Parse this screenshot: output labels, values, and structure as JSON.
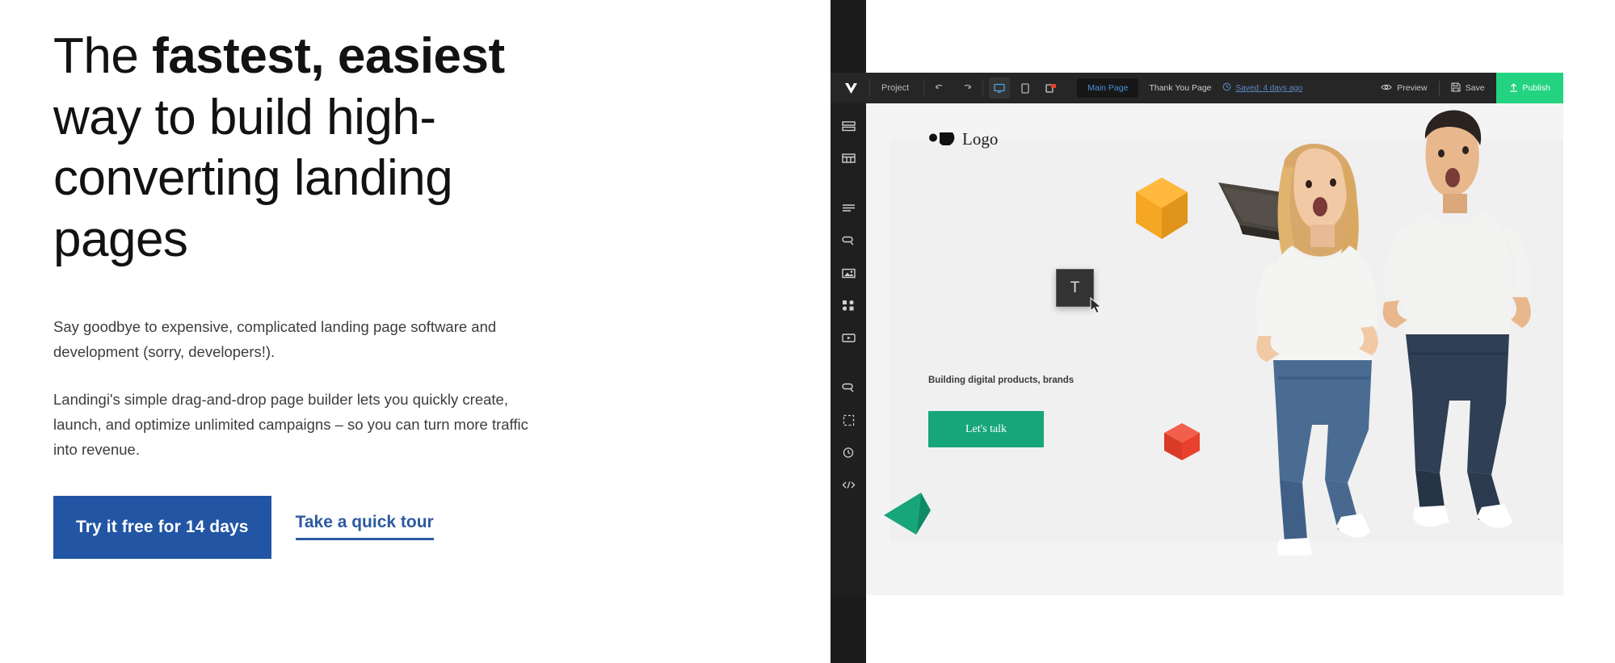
{
  "hero": {
    "headline_part1": "The ",
    "headline_bold": "fastest, easiest",
    "headline_part2": " way to build high-converting landing pages",
    "paragraph_1": "Say goodbye to expensive, complicated landing page software and development (sorry, developers!).",
    "paragraph_2": "Landingi's simple drag-and-drop page builder lets you quickly create, launch, and optimize unlimited campaigns – so you can turn more traffic into revenue.",
    "primary_cta": "Try it free for 14 days",
    "secondary_cta": "Take a quick tour",
    "colors": {
      "primary_button_bg": "#2255a4",
      "link": "#2c5aa0",
      "headline": "#121212",
      "body_text": "#3d3d3d"
    }
  },
  "app": {
    "toolbar": {
      "logo_icon": "landingi-logo-icon",
      "project_label": "Project",
      "undo_icon": "undo-icon",
      "redo_icon": "redo-icon",
      "desktop_icon": "desktop-view-icon",
      "mobile_icon": "mobile-view-icon",
      "popup_icon": "popup-view-icon",
      "tabs": [
        {
          "label": "Main Page",
          "active": true
        },
        {
          "label": "Thank You Page",
          "active": false
        }
      ],
      "saved_status": "Saved: 4 days ago",
      "saved_icon": "clock-icon",
      "preview_label": "Preview",
      "preview_icon": "eye-icon",
      "save_label": "Save",
      "save_icon": "floppy-disk-icon",
      "publish_label": "Publish",
      "publish_icon": "upload-icon",
      "publish_color": "#23d37f"
    },
    "sidebar": {
      "items": [
        {
          "icon": "section-icon",
          "name": "sidebar-item-sections"
        },
        {
          "icon": "layout-icon",
          "name": "sidebar-item-layouts"
        },
        {
          "icon": "text-block-icon",
          "name": "sidebar-item-text"
        },
        {
          "icon": "button-icon",
          "name": "sidebar-item-button"
        },
        {
          "icon": "image-icon",
          "name": "sidebar-item-image"
        },
        {
          "icon": "icons-icon",
          "name": "sidebar-item-icons"
        },
        {
          "icon": "video-icon",
          "name": "sidebar-item-video"
        },
        {
          "icon": "form-icon",
          "name": "sidebar-item-form"
        },
        {
          "icon": "box-icon",
          "name": "sidebar-item-box"
        },
        {
          "icon": "timer-icon",
          "name": "sidebar-item-timer"
        },
        {
          "icon": "code-icon",
          "name": "sidebar-item-code"
        }
      ]
    },
    "canvas": {
      "logo_text": "Logo",
      "logo_icon": "brand-mark-icon",
      "subheadline": "Building digital products, brands",
      "cta_label": "Let's talk",
      "cta_color": "#17a67a",
      "text_tool_glyph": "T",
      "cursor_icon": "mouse-pointer-icon",
      "shapes": [
        {
          "name": "green-tetrahedron",
          "color": "#17a67a"
        },
        {
          "name": "yellow-hexagon",
          "color": "#f5a623"
        },
        {
          "name": "red-cube",
          "color": "#e8412e"
        }
      ]
    }
  }
}
